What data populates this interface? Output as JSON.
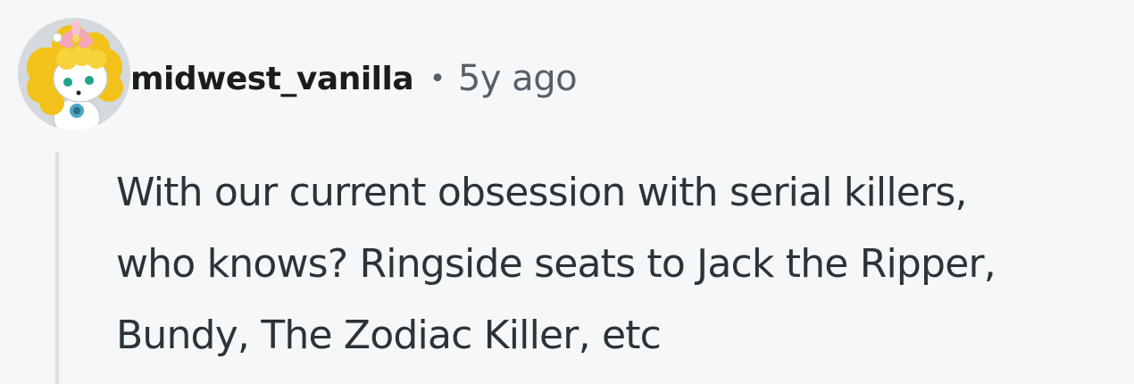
{
  "comment": {
    "author": "midwest_vanilla",
    "separator": "•",
    "timestamp": "5y ago",
    "body_lines": [
      "With our current obsession with serial killers,",
      "who knows? Ringside seats to Jack the Ripper,",
      "Bundy, The Zodiac Killer, etc"
    ]
  },
  "colors": {
    "background": "#f6f7f8",
    "author_text": "#1c1c1c",
    "meta_text": "#55606a",
    "body_text": "#2a3439",
    "thread_line": "#dde1e4",
    "avatar_hair": "#f2c21b"
  },
  "icons": {
    "avatar": "user-avatar-snoo"
  }
}
